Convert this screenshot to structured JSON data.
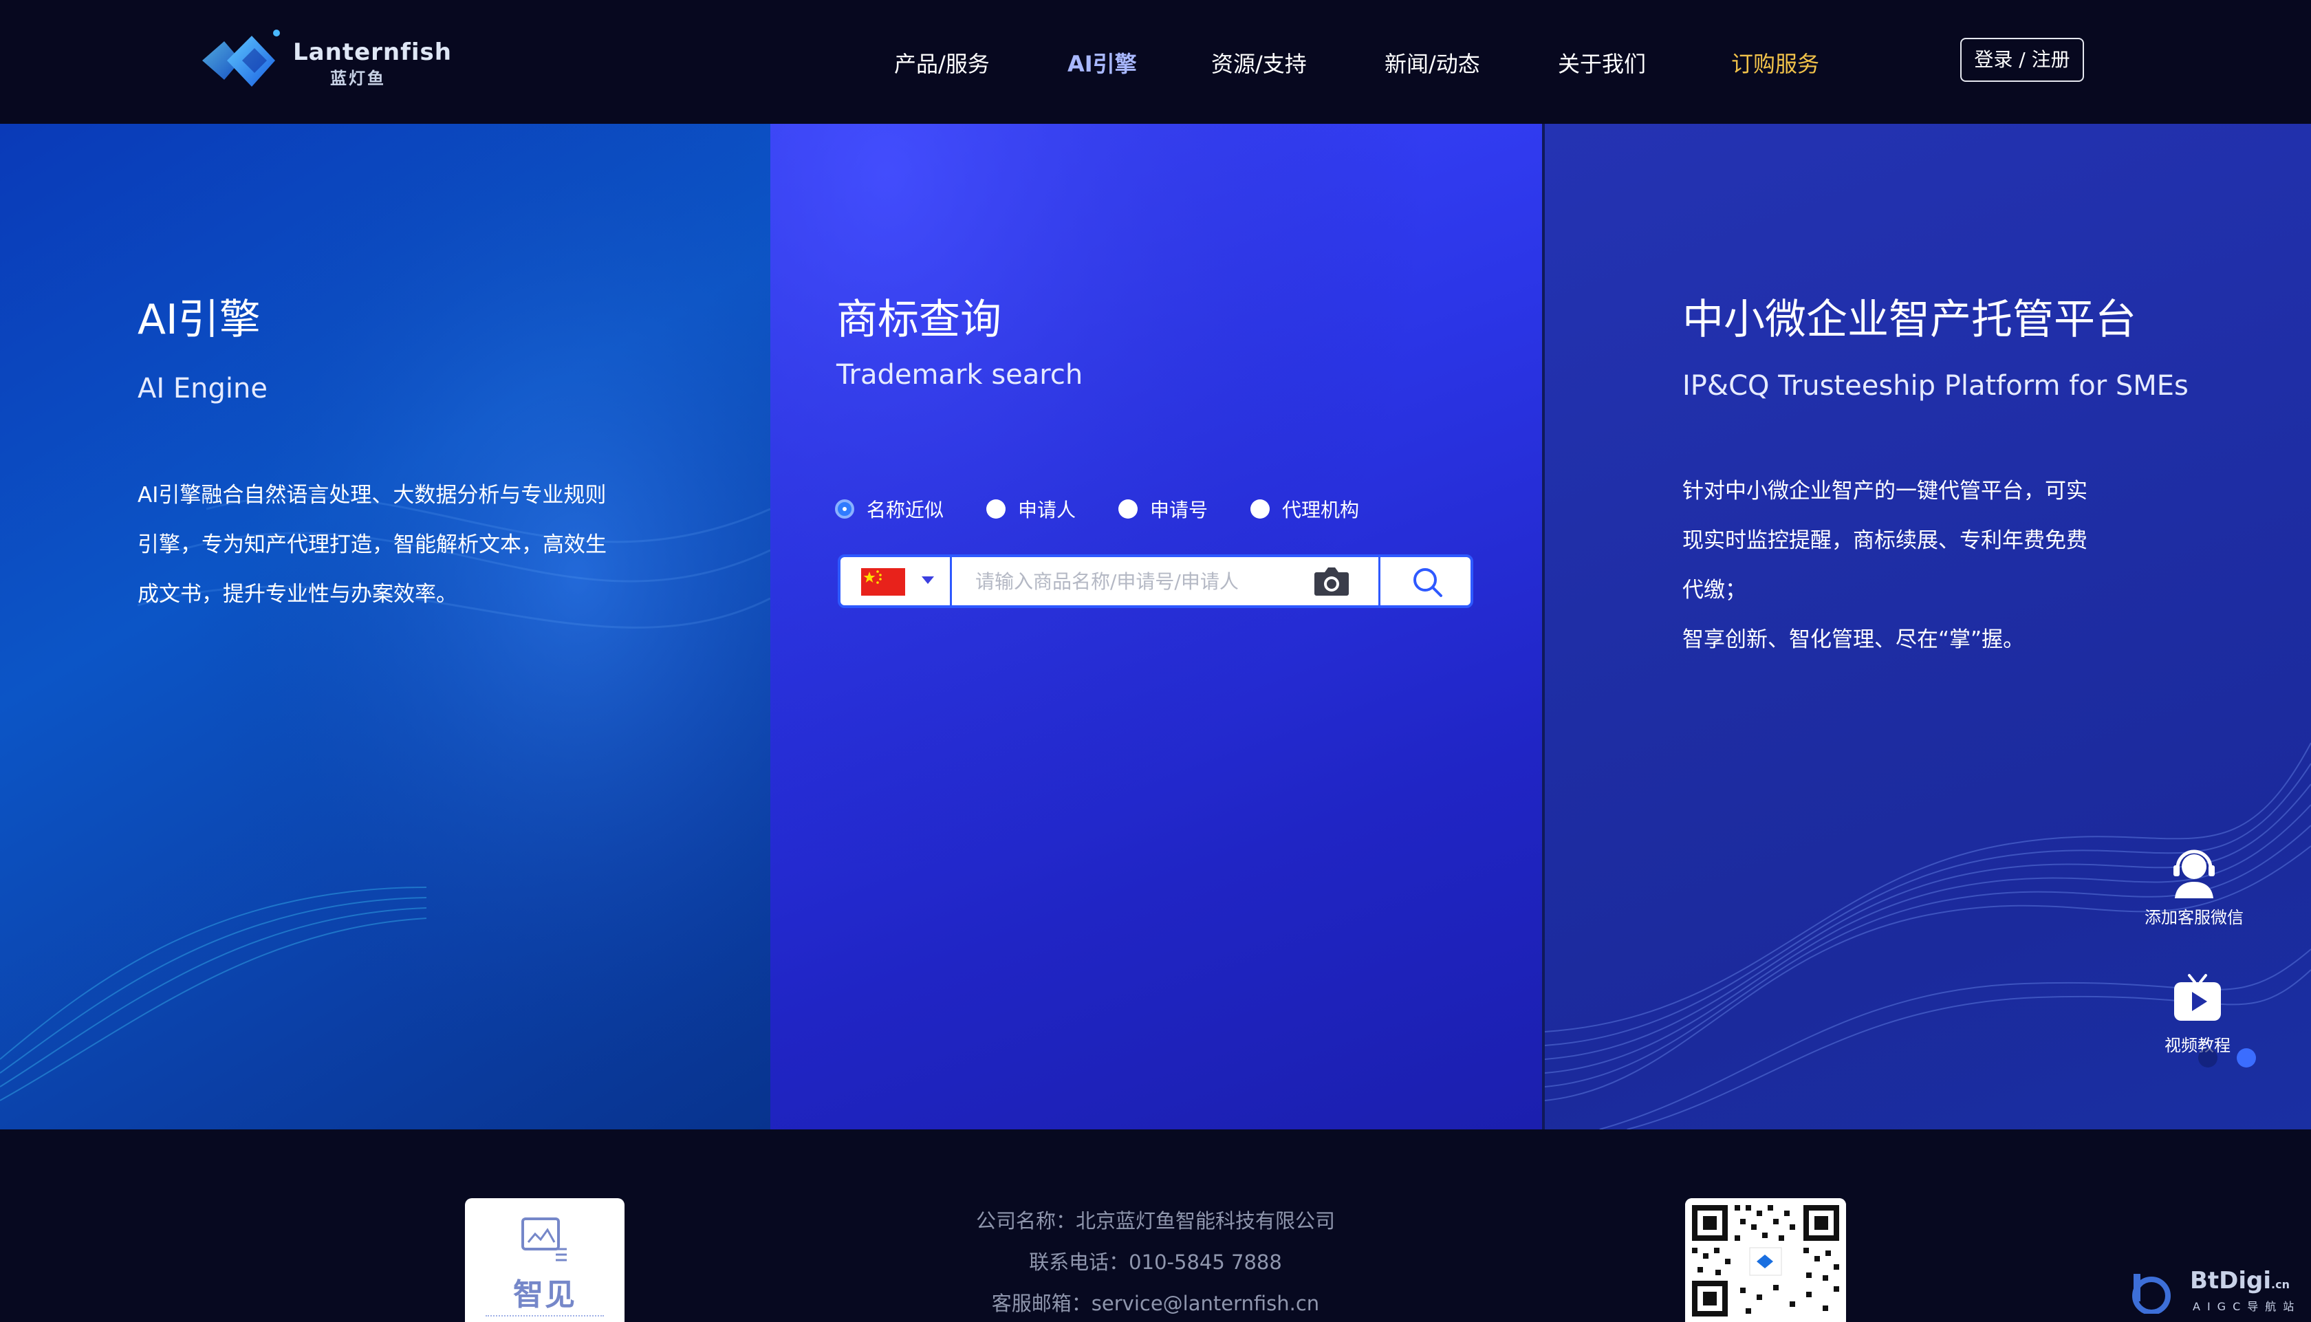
{
  "header": {
    "logo_text": "Lanternfish",
    "logo_sub": "蓝灯鱼",
    "nav": [
      {
        "label": "产品/服务"
      },
      {
        "label": "AI引擎"
      },
      {
        "label": "资源/支持"
      },
      {
        "label": "新闻/动态"
      },
      {
        "label": "关于我们"
      },
      {
        "label": "订购服务"
      }
    ],
    "login_label": "登录 / 注册",
    "colors": {
      "active": "#a9b8ff",
      "order": "#f1c24a"
    }
  },
  "left_panel": {
    "title": "AI引擎",
    "subtitle": "AI Engine",
    "desc_lines": [
      "AI引擎融合自然语言处理、大数据分析与专业规则",
      "引擎，专为知产代理打造，智能解析文本，高效生",
      "成文书，提升专业性与办案效率。"
    ]
  },
  "mid_panel": {
    "title": "商标查询",
    "subtitle": "Trademark search",
    "radios": [
      {
        "label": "名称近似",
        "selected": true
      },
      {
        "label": "申请人",
        "selected": false
      },
      {
        "label": "申请号",
        "selected": false
      },
      {
        "label": "代理机构",
        "selected": false
      }
    ],
    "search": {
      "country": "china-flag",
      "placeholder": "请输入商品名称/申请号/申请人",
      "value": ""
    }
  },
  "right_panel": {
    "title": "中小微企业智产托管平台",
    "subtitle": "IP&CQ Trusteeship Platform for SMEs",
    "desc_lines": [
      "针对中小微企业智产的一键代管平台，可实",
      "现实时监控提醒，商标续展、专利年费免费",
      "代缴；",
      "智享创新、智化管理、尽在“掌”握。"
    ]
  },
  "side_tools": [
    {
      "label": "添加客服微信",
      "icon": "customer-service-icon"
    },
    {
      "label": "视频教程",
      "icon": "video-tutorial-icon"
    }
  ],
  "footer": {
    "zhijian_label": "智见",
    "company": "公司名称：北京蓝灯鱼智能科技有限公司",
    "phone": "联系电话：010-5845 7888",
    "email": "客服邮箱：service@lanternfish.cn"
  },
  "watermark": {
    "text": "BtDigi",
    "suffix": ".cn",
    "sub": "AIGC导航站"
  }
}
